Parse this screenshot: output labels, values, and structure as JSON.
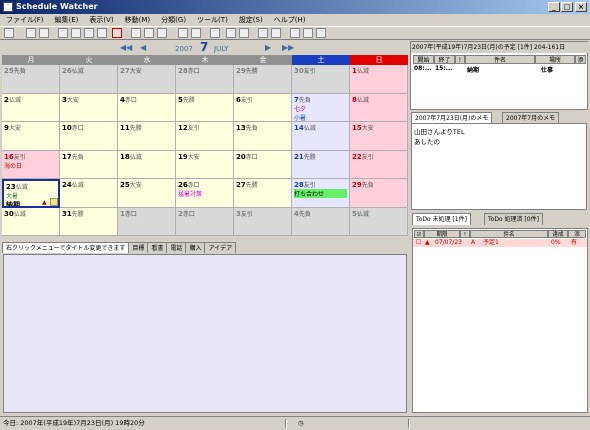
{
  "window": {
    "title": "Schedule Watcher"
  },
  "menu": [
    "ファイル(F)",
    "編集(E)",
    "表示(V)",
    "移動(M)",
    "分類(G)",
    "ツール(T)",
    "設定(S)",
    "ヘルプ(H)"
  ],
  "calendar": {
    "year": "2007",
    "month_num": "7",
    "month_name": "JULY",
    "weekdays": [
      "月",
      "火",
      "水",
      "木",
      "金",
      "土",
      "日"
    ],
    "weeks": [
      [
        {
          "d": "25",
          "r": "先負"
        },
        {
          "d": "26",
          "r": "仏滅"
        },
        {
          "d": "27",
          "r": "大安"
        },
        {
          "d": "28",
          "r": "赤口"
        },
        {
          "d": "29",
          "r": "先勝"
        },
        {
          "d": "30",
          "r": "友引"
        },
        {
          "d": "1",
          "r": "仏滅"
        }
      ],
      [
        {
          "d": "2",
          "r": "仏滅"
        },
        {
          "d": "3",
          "r": "大安"
        },
        {
          "d": "4",
          "r": "赤口"
        },
        {
          "d": "5",
          "r": "先勝"
        },
        {
          "d": "6",
          "r": "友引"
        },
        {
          "d": "7",
          "r": "先負",
          "e1": "七夕",
          "e2": "小暑"
        },
        {
          "d": "8",
          "r": "仏滅"
        }
      ],
      [
        {
          "d": "9",
          "r": "大安"
        },
        {
          "d": "10",
          "r": "赤口"
        },
        {
          "d": "11",
          "r": "先勝"
        },
        {
          "d": "12",
          "r": "友引"
        },
        {
          "d": "13",
          "r": "先負"
        },
        {
          "d": "14",
          "r": "仏滅"
        },
        {
          "d": "15",
          "r": "大安"
        }
      ],
      [
        {
          "d": "16",
          "r": "友引",
          "e1": "海の日"
        },
        {
          "d": "17",
          "r": "先負"
        },
        {
          "d": "18",
          "r": "仏滅"
        },
        {
          "d": "19",
          "r": "大安"
        },
        {
          "d": "20",
          "r": "赤口"
        },
        {
          "d": "21",
          "r": "先勝"
        },
        {
          "d": "22",
          "r": "友引"
        }
      ],
      [
        {
          "d": "23",
          "r": "仏滅",
          "e1": "大暑",
          "e2": "納期"
        },
        {
          "d": "24",
          "r": "仏滅"
        },
        {
          "d": "25",
          "r": "大安"
        },
        {
          "d": "26",
          "r": "赤口",
          "e1": "猛暑対策"
        },
        {
          "d": "27",
          "r": "先勝"
        },
        {
          "d": "28",
          "r": "友引",
          "e1": "打ち合わせ"
        },
        {
          "d": "29",
          "r": "先負"
        }
      ],
      [
        {
          "d": "30",
          "r": "仏滅"
        },
        {
          "d": "31",
          "r": "先勝"
        },
        {
          "d": "1",
          "r": "赤口"
        },
        {
          "d": "2",
          "r": "赤口"
        },
        {
          "d": "3",
          "r": "友引"
        },
        {
          "d": "4",
          "r": "先負"
        },
        {
          "d": "5",
          "r": "仏滅"
        }
      ]
    ]
  },
  "memo_tabs": [
    "右クリックメニューでタイトル変更できます",
    "目標",
    "看書",
    "電話",
    "購入",
    "アイデア"
  ],
  "status": {
    "text": "今日: 2007年(平成19年)7月23日(月) 19時20分"
  },
  "schedule": {
    "header": "2007年(平成19年)7月23日(月)の予定 [1件] 204-161日",
    "columns": [
      "開始",
      "終了",
      "!",
      "件名",
      "場所",
      "添"
    ],
    "row": {
      "start": "08:...",
      "end": "15:...",
      "title": "納期",
      "place": "仕事"
    }
  },
  "memo_panel": {
    "tabs": [
      "2007年7月23日(月)のメモ",
      "2007年7月のメモ"
    ],
    "lines": [
      "山田さんよりTEL",
      "あしたの"
    ]
  },
  "todo": {
    "tabs": [
      "ToDo 未処理 [1件]",
      "ToDo 処理済 [0件]"
    ],
    "columns": [
      "期限",
      "!",
      "件名",
      "達成",
      "添"
    ],
    "row": {
      "due": "07/07/23",
      "prio": "A",
      "title": "予定1",
      "done": "0%",
      "att": "有"
    }
  }
}
